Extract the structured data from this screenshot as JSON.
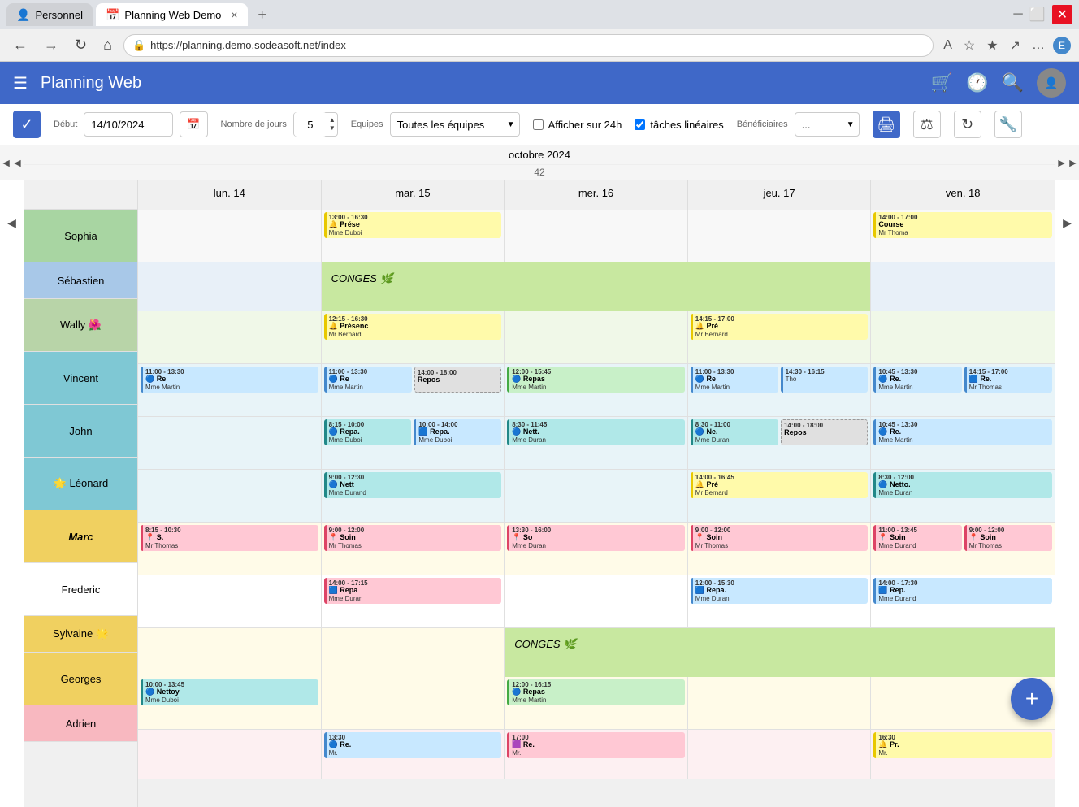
{
  "browser": {
    "tabs": [
      {
        "label": "Personnel",
        "active": false,
        "icon": "👤"
      },
      {
        "label": "Planning Web Demo",
        "active": true,
        "icon": "📅"
      }
    ],
    "url": "https://planning.demo.sodeasoft.net/index",
    "new_tab_label": "+"
  },
  "app": {
    "title": "Planning Web",
    "header_icons": [
      "🛒",
      "🕐",
      "🔍"
    ]
  },
  "toolbar": {
    "debut_label": "Début",
    "debut_value": "14/10/2024",
    "jours_label": "Nombre de jours",
    "jours_value": "5",
    "equipes_label": "Equipes",
    "equipes_value": "Toutes les équipes",
    "afficher_label": "Afficher sur 24h",
    "taches_label": "tâches linéaires",
    "beneficiaires_label": "Bénéficiaires",
    "beneficiaires_value": "..."
  },
  "calendar": {
    "month": "octobre 2024",
    "week": "42",
    "days": [
      {
        "label": "lun. 14"
      },
      {
        "label": "mar. 15"
      },
      {
        "label": "mer. 16"
      },
      {
        "label": "jeu. 17"
      },
      {
        "label": "ven. 18"
      }
    ],
    "rows": [
      {
        "id": "sophia",
        "label": "Sophia",
        "color_class": "row-sophia",
        "cells": [
          {
            "tasks": []
          },
          {
            "tasks": [
              {
                "type": "yellow",
                "time": "13:00 - 16:30",
                "label": "Prése",
                "person": "Mme Duboi"
              }
            ]
          },
          {
            "tasks": []
          },
          {
            "tasks": []
          },
          {
            "tasks": [
              {
                "type": "yellow",
                "time": "14:00 - 17:00",
                "label": "Course",
                "person": "Mr Thoma"
              }
            ]
          }
        ]
      },
      {
        "id": "sebastien",
        "label": "Sébastien",
        "color_class": "row-sebastien",
        "cells": [
          {
            "tasks": [],
            "conges": false
          },
          {
            "tasks": [],
            "conges": true,
            "conges_label": "CONGES 🌿",
            "conges_span": 3
          },
          {
            "tasks": [],
            "conges_hide": true
          },
          {
            "tasks": [],
            "conges_hide": true
          },
          {
            "tasks": []
          }
        ]
      },
      {
        "id": "wally",
        "label": "Wally 🌺",
        "color_class": "row-wally",
        "cells": [
          {
            "tasks": []
          },
          {
            "tasks": [
              {
                "type": "yellow",
                "time": "12:15 - 16:30",
                "label": "Présenc",
                "person": "Mr Bernard"
              }
            ]
          },
          {
            "tasks": []
          },
          {
            "tasks": [
              {
                "type": "yellow",
                "time": "14:15 - 17:00",
                "label": "Pré",
                "person": "Mr Bernard"
              }
            ]
          },
          {
            "tasks": []
          }
        ]
      },
      {
        "id": "vincent",
        "label": "Vincent",
        "color_class": "row-vincent",
        "cells": [
          {
            "tasks": [
              {
                "type": "blue",
                "time": "11:00 - 13:30",
                "label": "Re",
                "person": "Mme Martin"
              }
            ]
          },
          {
            "tasks": [
              {
                "type": "blue",
                "time": "11:00 - 13:30",
                "label": "Re",
                "person": "Mme Martin"
              },
              {
                "type": "gray",
                "time": "14:00 - 18:00",
                "label": "Repos",
                "person": ""
              }
            ]
          },
          {
            "tasks": [
              {
                "type": "green",
                "time": "12:00 - 15:45",
                "label": "Repas",
                "person": "Mme Martin"
              }
            ]
          },
          {
            "tasks": [
              {
                "type": "blue",
                "time": "11:00 - 13:30",
                "label": "Re",
                "person": "Mme Martin"
              },
              {
                "type": "blue",
                "time": "14:30 - 16:15",
                "label": "",
                "person": "Tho"
              }
            ]
          },
          {
            "tasks": [
              {
                "type": "blue",
                "time": "10:45 - 13:30",
                "label": "Re.",
                "person": "Mme Martin"
              },
              {
                "type": "blue",
                "time": "14:15 - 17:00",
                "label": "Re.",
                "person": "Mr Thomas"
              }
            ]
          }
        ]
      },
      {
        "id": "john",
        "label": "John",
        "color_class": "row-john",
        "cells": [
          {
            "tasks": []
          },
          {
            "tasks": [
              {
                "type": "teal",
                "time": "8:15 - 10:00",
                "label": "Repa.",
                "person": "Mme Duboi"
              },
              {
                "type": "blue",
                "time": "10:00 - 14:00",
                "label": "Repa.",
                "person": "Mme Duboi"
              }
            ]
          },
          {
            "tasks": [
              {
                "type": "teal",
                "time": "8:30 - 11:45",
                "label": "Nett.",
                "person": "Mme Duran"
              }
            ]
          },
          {
            "tasks": [
              {
                "type": "teal",
                "time": "8:30 - 11:00",
                "label": "Ne.",
                "person": "Mme Duran"
              },
              {
                "type": "gray",
                "time": "14:00 - 18:00",
                "label": "Repos",
                "person": ""
              }
            ]
          },
          {
            "tasks": [
              {
                "type": "blue",
                "time": "10:45 - 13:30",
                "label": "Re.",
                "person": "Mme Martin"
              }
            ]
          }
        ]
      },
      {
        "id": "leonard",
        "label": "🌟 Léonard",
        "color_class": "row-leonard",
        "cells": [
          {
            "tasks": []
          },
          {
            "tasks": [
              {
                "type": "teal",
                "time": "9:00 - 12:30",
                "label": "Nett",
                "person": "Mme Durand"
              }
            ]
          },
          {
            "tasks": []
          },
          {
            "tasks": [
              {
                "type": "yellow",
                "time": "14:00 - 16:45",
                "label": "Pré",
                "person": "Mr Bernard"
              }
            ]
          },
          {
            "tasks": [
              {
                "type": "teal",
                "time": "8:30 - 12:00",
                "label": "Netto.",
                "person": "Mme Duran"
              }
            ]
          }
        ]
      },
      {
        "id": "marc",
        "label": "Marc",
        "label_italic": true,
        "color_class": "row-marc",
        "cells": [
          {
            "tasks": [
              {
                "type": "pink",
                "time": "8:15 - 10:30",
                "label": "S.",
                "person": "Mr Thomas"
              }
            ]
          },
          {
            "tasks": [
              {
                "type": "pink",
                "time": "9:00 - 12:00",
                "label": "Soin",
                "person": "Mr Thomas"
              }
            ]
          },
          {
            "tasks": [
              {
                "type": "pink",
                "time": "13:30 - 16:00",
                "label": "So",
                "person": "Mme Duran"
              }
            ]
          },
          {
            "tasks": [
              {
                "type": "pink",
                "time": "9:00 - 12:00",
                "label": "Soin",
                "person": "Mr Thomas"
              }
            ]
          },
          {
            "tasks": [
              {
                "type": "pink",
                "time": "11:00 - 13:45",
                "label": "Soin",
                "person": "Mme Durand"
              },
              {
                "type": "pink",
                "time": "9:00 - 12:00",
                "label": "Soin",
                "person": "Mr Thomas"
              }
            ]
          }
        ]
      },
      {
        "id": "frederic",
        "label": "Frederic",
        "color_class": "row-frederic",
        "cells": [
          {
            "tasks": []
          },
          {
            "tasks": [
              {
                "type": "pink",
                "time": "14:00 - 17:15",
                "label": "Repa",
                "person": "Mme Duran"
              }
            ]
          },
          {
            "tasks": []
          },
          {
            "tasks": [
              {
                "type": "blue",
                "time": "12:00 - 15:30",
                "label": "Repa.",
                "person": "Mme Duran"
              }
            ]
          },
          {
            "tasks": [
              {
                "type": "blue",
                "time": "14:00 - 17:30",
                "label": "Rep.",
                "person": "Mme Durand"
              }
            ]
          }
        ]
      },
      {
        "id": "sylvaine",
        "label": "Sylvaine 🌟",
        "color_class": "row-sylvaine",
        "cells": [
          {
            "tasks": []
          },
          {
            "tasks": []
          },
          {
            "tasks": [],
            "conges": true,
            "conges_label": "CONGES 🌿",
            "conges_span": 4
          },
          {
            "tasks": [],
            "conges_hide": true
          },
          {
            "tasks": [],
            "conges_hide": true
          }
        ]
      },
      {
        "id": "georges",
        "label": "Georges",
        "color_class": "row-georges",
        "cells": [
          {
            "tasks": [
              {
                "type": "teal",
                "time": "10:00 - 13:45",
                "label": "Nettoy",
                "person": "Mme Duboi"
              }
            ]
          },
          {
            "tasks": []
          },
          {
            "tasks": [
              {
                "type": "green",
                "time": "12:00 - 16:15",
                "label": "Repas",
                "person": "Mme Martin"
              }
            ]
          },
          {
            "tasks": []
          },
          {
            "tasks": []
          }
        ]
      },
      {
        "id": "adrien",
        "label": "Adrien",
        "color_class": "row-adrien",
        "cells": [
          {
            "tasks": []
          },
          {
            "tasks": [
              {
                "type": "blue",
                "time": "13:30",
                "label": "Re.",
                "person": "Mr."
              }
            ]
          },
          {
            "tasks": [
              {
                "type": "pink",
                "time": "17:00",
                "label": "Re.",
                "person": "Mr."
              }
            ]
          },
          {
            "tasks": []
          },
          {
            "tasks": [
              {
                "type": "yellow",
                "time": "16:30",
                "label": "Pr.",
                "person": "Mr."
              }
            ]
          }
        ]
      }
    ]
  },
  "fab": {
    "label": "+"
  }
}
